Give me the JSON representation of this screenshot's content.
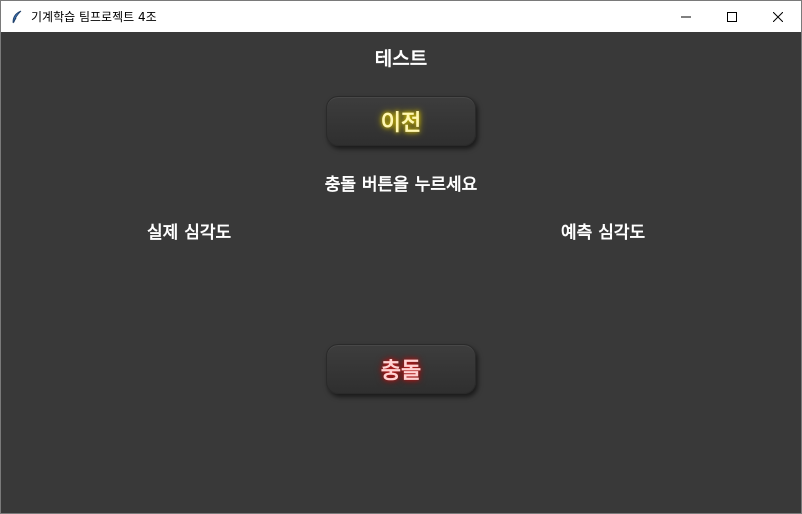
{
  "window": {
    "title": "기계학습 팀프로젝트 4조",
    "app_icon": "feather-icon",
    "controls": [
      "minimize-icon",
      "maximize-icon",
      "close-icon"
    ]
  },
  "main": {
    "heading": "테스트",
    "prev_button": "이전",
    "instruction": "충돌 버튼을 누르세요",
    "actual_label": "실제 심각도",
    "predicted_label": "예측 심각도",
    "collide_button": "충돌"
  },
  "colors": {
    "background": "#393939",
    "prev_glow": "#d8c400",
    "collide_glow": "#c11a1a"
  }
}
